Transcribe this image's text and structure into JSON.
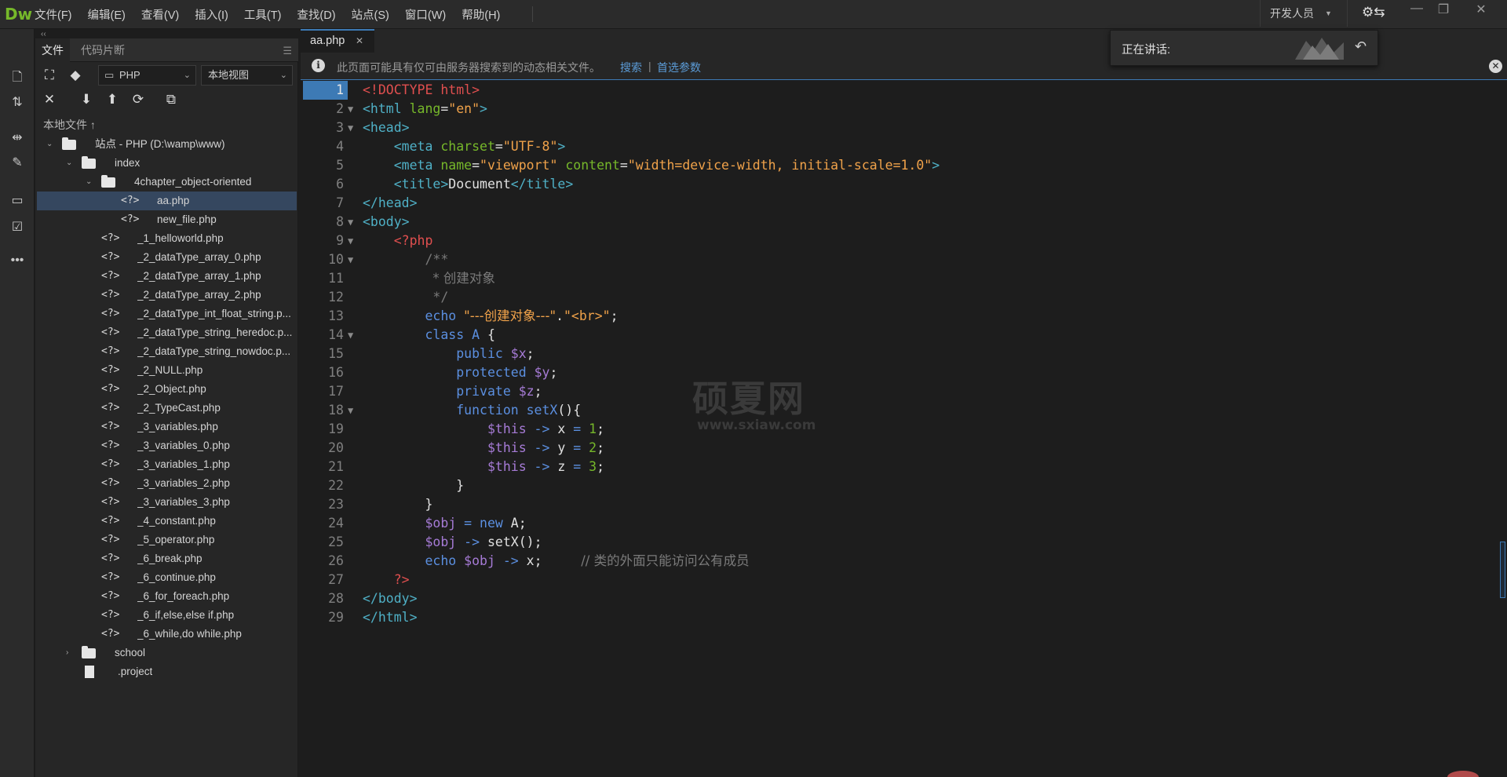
{
  "app": {
    "logo": "Dw"
  },
  "menu": [
    "文件(F)",
    "编辑(E)",
    "查看(V)",
    "插入(I)",
    "工具(T)",
    "查找(D)",
    "站点(S)",
    "窗口(W)",
    "帮助(H)"
  ],
  "workspace": {
    "label": "开发人员"
  },
  "window_controls": {
    "minimize": "—",
    "restore": "❐",
    "close": "✕"
  },
  "panel": {
    "collapse": "‹‹",
    "tabs": [
      "文件",
      "代码片断"
    ],
    "site_dropdown": "PHP",
    "view_dropdown": "本地视图",
    "section_label": "本地文件 ↑",
    "tree": [
      {
        "name": "站点 - PHP (D:\\wamp\\www)",
        "type": "folder",
        "depth": 0,
        "expanded": true
      },
      {
        "name": "index",
        "type": "folder",
        "depth": 1,
        "expanded": true
      },
      {
        "name": "4chapter_object-oriented",
        "type": "folder",
        "depth": 2,
        "expanded": true
      },
      {
        "name": "aa.php",
        "type": "php",
        "depth": 3,
        "selected": true
      },
      {
        "name": "new_file.php",
        "type": "php",
        "depth": 3
      },
      {
        "name": "_1_helloworld.php",
        "type": "php",
        "depth": 2
      },
      {
        "name": "_2_dataType_array_0.php",
        "type": "php",
        "depth": 2
      },
      {
        "name": "_2_dataType_array_1.php",
        "type": "php",
        "depth": 2
      },
      {
        "name": "_2_dataType_array_2.php",
        "type": "php",
        "depth": 2
      },
      {
        "name": "_2_dataType_int_float_string.p...",
        "type": "php",
        "depth": 2
      },
      {
        "name": "_2_dataType_string_heredoc.p...",
        "type": "php",
        "depth": 2
      },
      {
        "name": "_2_dataType_string_nowdoc.p...",
        "type": "php",
        "depth": 2
      },
      {
        "name": "_2_NULL.php",
        "type": "php",
        "depth": 2
      },
      {
        "name": "_2_Object.php",
        "type": "php",
        "depth": 2
      },
      {
        "name": "_2_TypeCast.php",
        "type": "php",
        "depth": 2
      },
      {
        "name": "_3_variables.php",
        "type": "php",
        "depth": 2
      },
      {
        "name": "_3_variables_0.php",
        "type": "php",
        "depth": 2
      },
      {
        "name": "_3_variables_1.php",
        "type": "php",
        "depth": 2
      },
      {
        "name": "_3_variables_2.php",
        "type": "php",
        "depth": 2
      },
      {
        "name": "_3_variables_3.php",
        "type": "php",
        "depth": 2
      },
      {
        "name": "_4_constant.php",
        "type": "php",
        "depth": 2
      },
      {
        "name": "_5_operator.php",
        "type": "php",
        "depth": 2
      },
      {
        "name": "_6_break.php",
        "type": "php",
        "depth": 2
      },
      {
        "name": "_6_continue.php",
        "type": "php",
        "depth": 2
      },
      {
        "name": "_6_for_foreach.php",
        "type": "php",
        "depth": 2
      },
      {
        "name": "_6_if,else,else if.php",
        "type": "php",
        "depth": 2
      },
      {
        "name": "_6_while,do while.php",
        "type": "php",
        "depth": 2
      },
      {
        "name": "school",
        "type": "folder",
        "depth": 1,
        "expanded": false
      },
      {
        "name": ".project",
        "type": "doc",
        "depth": 1
      }
    ]
  },
  "editor": {
    "tab": {
      "label": "aa.php",
      "close": "✕"
    },
    "info": {
      "icon": "i",
      "message": "此页面可能具有仅可由服务器搜索到的动态相关文件。",
      "link_search": "搜索",
      "separator": "|",
      "link_prefs": "首选参数",
      "close": "✕"
    },
    "current_line": 1,
    "lines": [
      {
        "n": "1",
        "fold": false,
        "t": [
          [
            "t-doc",
            "<!DOCTYPE html>"
          ]
        ]
      },
      {
        "n": "2",
        "fold": true,
        "t": [
          [
            "t-tag",
            "<html "
          ],
          [
            "t-attr",
            "lang"
          ],
          [
            "t-txt",
            "="
          ],
          [
            "t-str",
            "\"en\""
          ],
          [
            "t-tag",
            ">"
          ]
        ]
      },
      {
        "n": "3",
        "fold": true,
        "t": [
          [
            "t-tag",
            "<head>"
          ]
        ]
      },
      {
        "n": "4",
        "fold": false,
        "t": [
          [
            "t-txt",
            "    "
          ],
          [
            "t-tag",
            "<meta "
          ],
          [
            "t-attr",
            "charset"
          ],
          [
            "t-txt",
            "="
          ],
          [
            "t-str",
            "\"UTF-8\""
          ],
          [
            "t-tag",
            ">"
          ]
        ]
      },
      {
        "n": "5",
        "fold": false,
        "t": [
          [
            "t-txt",
            "    "
          ],
          [
            "t-tag",
            "<meta "
          ],
          [
            "t-attr",
            "name"
          ],
          [
            "t-txt",
            "="
          ],
          [
            "t-str",
            "\"viewport\""
          ],
          [
            "t-txt",
            " "
          ],
          [
            "t-attr",
            "content"
          ],
          [
            "t-txt",
            "="
          ],
          [
            "t-str",
            "\"width=device-width, initial-scale=1.0\""
          ],
          [
            "t-tag",
            ">"
          ]
        ]
      },
      {
        "n": "6",
        "fold": false,
        "t": [
          [
            "t-txt",
            "    "
          ],
          [
            "t-tag",
            "<title>"
          ],
          [
            "t-txt",
            "Document"
          ],
          [
            "t-tag",
            "</title>"
          ]
        ]
      },
      {
        "n": "7",
        "fold": false,
        "t": [
          [
            "t-tag",
            "</head>"
          ]
        ]
      },
      {
        "n": "8",
        "fold": true,
        "t": [
          [
            "t-tag",
            "<body>"
          ]
        ]
      },
      {
        "n": "9",
        "fold": true,
        "t": [
          [
            "t-txt",
            "    "
          ],
          [
            "t-php",
            "<?php"
          ]
        ]
      },
      {
        "n": "10",
        "fold": true,
        "t": [
          [
            "t-txt",
            "        "
          ],
          [
            "t-cmt",
            "/**"
          ]
        ]
      },
      {
        "n": "11",
        "fold": false,
        "t": [
          [
            "t-txt",
            "         "
          ],
          [
            "t-cmt",
            "* 创建对象"
          ]
        ]
      },
      {
        "n": "12",
        "fold": false,
        "t": [
          [
            "t-txt",
            "         "
          ],
          [
            "t-cmt",
            "*/"
          ]
        ]
      },
      {
        "n": "13",
        "fold": false,
        "t": [
          [
            "t-txt",
            "        "
          ],
          [
            "t-kw",
            "echo "
          ],
          [
            "t-str",
            "\"---创建对象---\""
          ],
          [
            "t-txt",
            "."
          ],
          [
            "t-str",
            "\"<br>\""
          ],
          [
            "t-txt",
            ";"
          ]
        ]
      },
      {
        "n": "14",
        "fold": true,
        "t": [
          [
            "t-txt",
            "        "
          ],
          [
            "t-kw",
            "class "
          ],
          [
            "t-kw",
            "A"
          ],
          [
            "t-txt",
            " {"
          ]
        ]
      },
      {
        "n": "15",
        "fold": false,
        "t": [
          [
            "t-txt",
            "            "
          ],
          [
            "t-kw",
            "public "
          ],
          [
            "t-var",
            "$x"
          ],
          [
            "t-txt",
            ";"
          ]
        ]
      },
      {
        "n": "16",
        "fold": false,
        "t": [
          [
            "t-txt",
            "            "
          ],
          [
            "t-kw",
            "protected "
          ],
          [
            "t-var",
            "$y"
          ],
          [
            "t-txt",
            ";"
          ]
        ]
      },
      {
        "n": "17",
        "fold": false,
        "t": [
          [
            "t-txt",
            "            "
          ],
          [
            "t-kw",
            "private "
          ],
          [
            "t-var",
            "$z"
          ],
          [
            "t-txt",
            ";"
          ]
        ]
      },
      {
        "n": "18",
        "fold": true,
        "t": [
          [
            "t-txt",
            "            "
          ],
          [
            "t-kw",
            "function "
          ],
          [
            "t-kw",
            "setX"
          ],
          [
            "t-txt",
            "(){"
          ]
        ]
      },
      {
        "n": "19",
        "fold": false,
        "t": [
          [
            "t-txt",
            "                "
          ],
          [
            "t-var",
            "$this"
          ],
          [
            "t-op",
            " -> "
          ],
          [
            "t-txt",
            "x "
          ],
          [
            "t-op",
            "= "
          ],
          [
            "t-num",
            "1"
          ],
          [
            "t-txt",
            ";"
          ]
        ]
      },
      {
        "n": "20",
        "fold": false,
        "t": [
          [
            "t-txt",
            "                "
          ],
          [
            "t-var",
            "$this"
          ],
          [
            "t-op",
            " -> "
          ],
          [
            "t-txt",
            "y "
          ],
          [
            "t-op",
            "= "
          ],
          [
            "t-num",
            "2"
          ],
          [
            "t-txt",
            ";"
          ]
        ]
      },
      {
        "n": "21",
        "fold": false,
        "t": [
          [
            "t-txt",
            "                "
          ],
          [
            "t-var",
            "$this"
          ],
          [
            "t-op",
            " -> "
          ],
          [
            "t-txt",
            "z "
          ],
          [
            "t-op",
            "= "
          ],
          [
            "t-num",
            "3"
          ],
          [
            "t-txt",
            ";"
          ]
        ]
      },
      {
        "n": "22",
        "fold": false,
        "t": [
          [
            "t-txt",
            "            }"
          ]
        ]
      },
      {
        "n": "23",
        "fold": false,
        "t": [
          [
            "t-txt",
            "        }"
          ]
        ]
      },
      {
        "n": "24",
        "fold": false,
        "t": [
          [
            "t-txt",
            "        "
          ],
          [
            "t-var",
            "$obj"
          ],
          [
            "t-op",
            " = "
          ],
          [
            "t-kw",
            "new "
          ],
          [
            "t-txt",
            "A;"
          ]
        ]
      },
      {
        "n": "25",
        "fold": false,
        "t": [
          [
            "t-txt",
            "        "
          ],
          [
            "t-var",
            "$obj"
          ],
          [
            "t-op",
            " -> "
          ],
          [
            "t-txt",
            "setX();"
          ]
        ]
      },
      {
        "n": "26",
        "fold": false,
        "t": [
          [
            "t-txt",
            "        "
          ],
          [
            "t-kw",
            "echo "
          ],
          [
            "t-var",
            "$obj"
          ],
          [
            "t-op",
            " -> "
          ],
          [
            "t-txt",
            "x;     "
          ],
          [
            "t-cmt",
            "// 类的外面只能访问公有成员"
          ]
        ]
      },
      {
        "n": "27",
        "fold": false,
        "t": [
          [
            "t-txt",
            "    "
          ],
          [
            "t-php",
            "?>"
          ]
        ]
      },
      {
        "n": "28",
        "fold": false,
        "t": [
          [
            "t-tag",
            "</body>"
          ]
        ]
      },
      {
        "n": "29",
        "fold": false,
        "t": [
          [
            "t-tag",
            "</html>"
          ]
        ]
      }
    ]
  },
  "speaking": {
    "label": "正在讲话:"
  },
  "watermark": {
    "title": "硕夏网",
    "url": "www.sxiaw.com"
  },
  "icons": {
    "new_file": "new-file-icon",
    "sync": "sync-arrows-icon",
    "expand": "expand-icon",
    "brush": "brush-icon",
    "chat": "chat-icon",
    "checklist": "checklist-icon",
    "more": "more-icon"
  }
}
